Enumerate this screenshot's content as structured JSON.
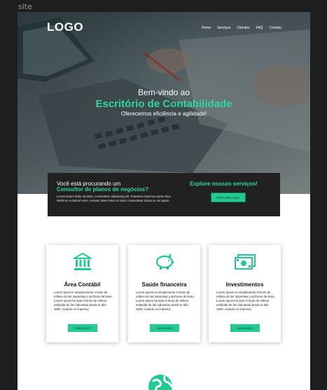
{
  "canvas": {
    "label": "site"
  },
  "header": {
    "logo": "LOGO",
    "nav": [
      "Home",
      "Serviços",
      "Clientes",
      "FAQ",
      "Contato"
    ]
  },
  "hero": {
    "welcome": "Bem-vindo ao",
    "title": "Escritório de Contabilidade",
    "tagline": "Oferecemos eficiência e agilidade!"
  },
  "cta": {
    "line1": "Você está procurando um",
    "line2": "Consultor de planos de negócios?",
    "body": "Lorem ipsum dolor sit amet, consectetur adipiscing elit. Praesent maximus porta risus. Morbi eu euismod enim. Aenean vitae tortor ac tortor consectetur luctus ac vel quam.",
    "explore": "Explore nossos serviços!",
    "button": "EXPLORE AQUI"
  },
  "cards": [
    {
      "icon": "bank-icon",
      "title": "Área Contábil",
      "body": "Lorem Ipsum é simplesmente o texto de relleno de las imprentas y archivos de texto. Lorem Ipsum ha sido el texto de relleno estándar de las industrias desde el año 1500, cuando un impresor",
      "button": "SAIBA MAIS"
    },
    {
      "icon": "piggy-bank-icon",
      "title": "Saúde financeira",
      "body": "Lorem Ipsum es simplemente el texto de relleno de las imprentas y archivos de texto. Lorem Ipsum ha sido el texto de relleno estándar de las industrias desde el año 1500, cuando un impresor",
      "button": "SAIBA MAIS"
    },
    {
      "icon": "money-icon",
      "title": "Investimentos",
      "body": "Lorem Ipsum es simplemente el texto de relleno de las imprentas y archivos de texto. Lorem Ipsum ha sido el texto de relleno estándar de las industrias desde el año 1500, cuando un impresor",
      "button": "SAIBA MAIS"
    }
  ],
  "bottom": {
    "icon": "globe-icon"
  },
  "colors": {
    "accent": "#2fd79c",
    "button": "#22c994",
    "dark": "#212121",
    "canvas": "#1e1e1e"
  }
}
